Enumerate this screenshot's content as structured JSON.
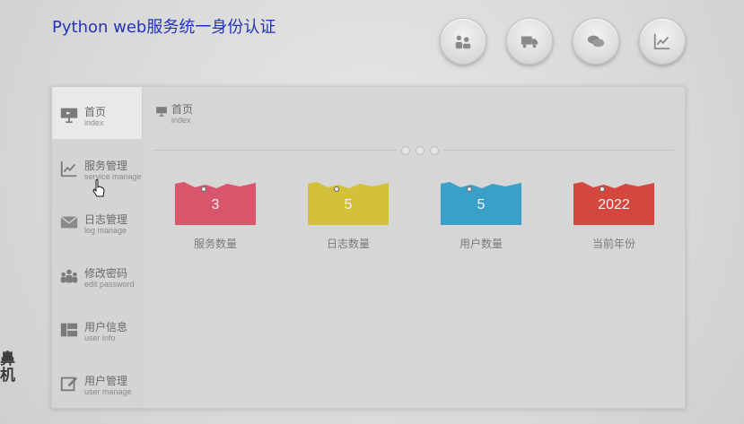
{
  "app": {
    "title": "Python web服务统一身份认证"
  },
  "top_icons": [
    "users-icon",
    "truck-icon",
    "chat-icon",
    "chart-icon"
  ],
  "sidebar": {
    "items": [
      {
        "cn": "首页",
        "en": "index",
        "icon": "presentation-icon"
      },
      {
        "cn": "服务管理",
        "en": "service manage",
        "icon": "line-chart-icon"
      },
      {
        "cn": "日志管理",
        "en": "log manage",
        "icon": "envelope-icon"
      },
      {
        "cn": "修改密码",
        "en": "edit password",
        "icon": "group-icon"
      },
      {
        "cn": "用户信息",
        "en": "user info",
        "icon": "layout-icon"
      },
      {
        "cn": "用户管理",
        "en": "user manage",
        "icon": "edit-icon"
      }
    ]
  },
  "breadcrumb": {
    "cn": "首页",
    "en": "index"
  },
  "cards": [
    {
      "value": "3",
      "label": "服务数量",
      "color": "#d9556c"
    },
    {
      "value": "5",
      "label": "日志数量",
      "color": "#d4c03a"
    },
    {
      "value": "5",
      "label": "用户数量",
      "color": "#3aa0c8"
    },
    {
      "value": "2022",
      "label": "当前年份",
      "color": "#d3473f"
    }
  ],
  "watermark": {
    "line1": "鼻",
    "line2": "机"
  }
}
